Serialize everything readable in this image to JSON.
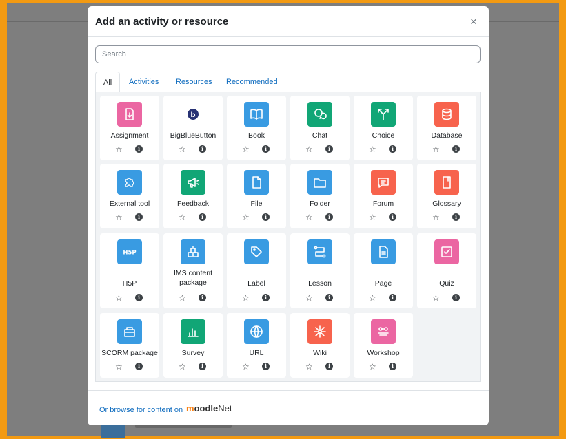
{
  "modal": {
    "title": "Add an activity or resource",
    "close_symbol": "×"
  },
  "search": {
    "placeholder": "Search",
    "value": ""
  },
  "tabs": [
    {
      "label": "All",
      "active": true
    },
    {
      "label": "Activities",
      "active": false
    },
    {
      "label": "Resources",
      "active": false
    },
    {
      "label": "Recommended",
      "active": false
    }
  ],
  "items": [
    {
      "label": "Assignment",
      "color": "#eb66a2",
      "icon": "assignment-icon"
    },
    {
      "label": "BigBlueButton",
      "color": "#ffffff",
      "icon": "bigbluebutton-icon"
    },
    {
      "label": "Book",
      "color": "#399be2",
      "icon": "book-icon"
    },
    {
      "label": "Chat",
      "color": "#11a676",
      "icon": "chat-icon"
    },
    {
      "label": "Choice",
      "color": "#11a676",
      "icon": "choice-icon"
    },
    {
      "label": "Database",
      "color": "#f7634d",
      "icon": "database-icon"
    },
    {
      "label": "External tool",
      "color": "#399be2",
      "icon": "puzzle-icon"
    },
    {
      "label": "Feedback",
      "color": "#11a676",
      "icon": "megaphone-icon"
    },
    {
      "label": "File",
      "color": "#399be2",
      "icon": "file-icon"
    },
    {
      "label": "Folder",
      "color": "#399be2",
      "icon": "folder-icon"
    },
    {
      "label": "Forum",
      "color": "#f7634d",
      "icon": "forum-icon"
    },
    {
      "label": "Glossary",
      "color": "#f7634d",
      "icon": "glossary-icon"
    },
    {
      "label": "H5P",
      "color": "#399be2",
      "icon": "h5p-icon"
    },
    {
      "label": "IMS content package",
      "color": "#399be2",
      "icon": "package-icon"
    },
    {
      "label": "Label",
      "color": "#399be2",
      "icon": "tag-icon"
    },
    {
      "label": "Lesson",
      "color": "#399be2",
      "icon": "lesson-icon"
    },
    {
      "label": "Page",
      "color": "#399be2",
      "icon": "page-icon"
    },
    {
      "label": "Quiz",
      "color": "#eb66a2",
      "icon": "quiz-icon"
    },
    {
      "label": "SCORM package",
      "color": "#399be2",
      "icon": "scorm-icon"
    },
    {
      "label": "Survey",
      "color": "#11a676",
      "icon": "survey-icon"
    },
    {
      "label": "URL",
      "color": "#399be2",
      "icon": "globe-icon"
    },
    {
      "label": "Wiki",
      "color": "#f7634d",
      "icon": "wiki-icon"
    },
    {
      "label": "Workshop",
      "color": "#eb66a2",
      "icon": "workshop-icon"
    }
  ],
  "item_actions": {
    "star_symbol": "☆",
    "info_symbol": "i"
  },
  "footer": {
    "prefix": "Or browse for content on",
    "brand_m": "m",
    "brand_oodle": "oodle",
    "brand_net": "Net"
  }
}
